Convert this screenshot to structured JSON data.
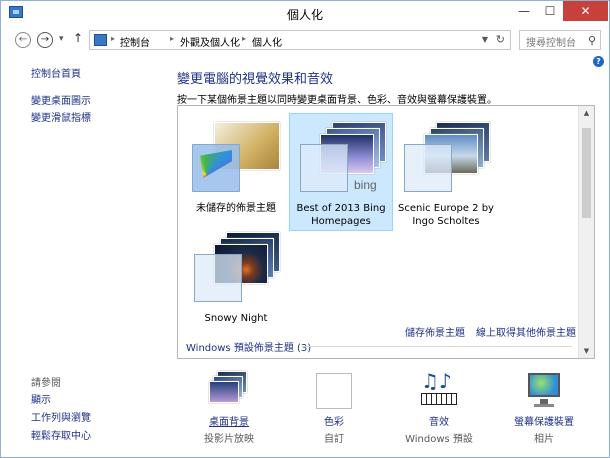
{
  "window": {
    "title": "個人化",
    "minimize": "—",
    "maximize": "☐",
    "close": "✕"
  },
  "nav": {
    "back": "←",
    "forward": "→",
    "recent": "▾",
    "up": "↑",
    "breadcrumbs": [
      "控制台",
      "外觀及個人化",
      "個人化"
    ],
    "search_placeholder": "搜尋控制台"
  },
  "sidebar": {
    "home": "控制台首頁",
    "links": [
      "變更桌面圖示",
      "變更滑鼠指標"
    ],
    "see_also_heading": "請參閱",
    "see_also": [
      "顯示",
      "工作列與瀏覽",
      "輕鬆存取中心"
    ]
  },
  "main": {
    "heading": "變更電腦的視覺效果和音效",
    "instructions": "按一下某個佈景主題以同時變更桌面背景、色彩、音效與螢幕保護裝置。",
    "themes": [
      {
        "label": "未儲存的佈景主題",
        "selected": false
      },
      {
        "label": "Best of 2013 Bing Homepages",
        "selected": true,
        "badge": "bing"
      },
      {
        "label": "Scenic Europe 2 by Ingo Scholtes",
        "selected": false
      },
      {
        "label": "Snowy Night",
        "selected": false
      }
    ],
    "save_theme": "儲存佈景主題",
    "get_more_themes": "線上取得其他佈景主題",
    "group_heading": "Windows 預設佈景主題 (3)"
  },
  "settings": [
    {
      "label": "桌面背景",
      "value": "投影片放映",
      "icon": "desktop-background-icon"
    },
    {
      "label": "色彩",
      "value": "自訂",
      "icon": "color-icon"
    },
    {
      "label": "音效",
      "value": "Windows 預設",
      "icon": "sound-icon"
    },
    {
      "label": "螢幕保護裝置",
      "value": "相片",
      "icon": "screensaver-icon"
    }
  ],
  "colors": {
    "link": "#1e3287",
    "selection": "#cce8ff",
    "close": "#c7413b"
  }
}
